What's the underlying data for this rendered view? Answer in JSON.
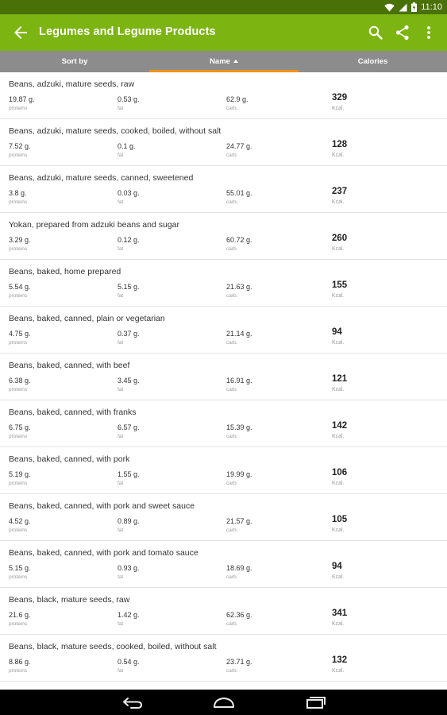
{
  "status": {
    "time": "11:10"
  },
  "app_bar": {
    "title": "Legumes and Legume Products"
  },
  "tabs": {
    "sort_by": "Sort by",
    "name": "Name",
    "calories": "Calories"
  },
  "foods": [
    {
      "name": "Beans, adzuki, mature seeds, raw",
      "protein": "19.87 g.",
      "fat": "0.53 g.",
      "carbs": "62.9 g.",
      "kcal": "329"
    },
    {
      "name": "Beans, adzuki, mature seeds, cooked, boiled, without salt",
      "protein": "7.52 g.",
      "fat": "0.1 g.",
      "carbs": "24.77 g.",
      "kcal": "128"
    },
    {
      "name": "Beans, adzuki, mature seeds, canned, sweetened",
      "protein": "3.8 g.",
      "fat": "0.03 g.",
      "carbs": "55.01 g.",
      "kcal": "237"
    },
    {
      "name": "Yokan, prepared from adzuki beans and sugar",
      "protein": "3.29 g.",
      "fat": "0.12 g.",
      "carbs": "60.72 g.",
      "kcal": "260"
    },
    {
      "name": "Beans, baked, home prepared",
      "protein": "5.54 g.",
      "fat": "5.15 g.",
      "carbs": "21.63 g.",
      "kcal": "155"
    },
    {
      "name": "Beans, baked, canned, plain or vegetarian",
      "protein": "4.75 g.",
      "fat": "0.37 g.",
      "carbs": "21.14 g.",
      "kcal": "94"
    },
    {
      "name": "Beans, baked, canned, with beef",
      "protein": "6.38 g.",
      "fat": "3.45 g.",
      "carbs": "16.91 g.",
      "kcal": "121"
    },
    {
      "name": "Beans, baked, canned, with franks",
      "protein": "6.75 g.",
      "fat": "6.57 g.",
      "carbs": "15.39 g.",
      "kcal": "142"
    },
    {
      "name": "Beans, baked, canned, with pork",
      "protein": "5.19 g.",
      "fat": "1.55 g.",
      "carbs": "19.99 g.",
      "kcal": "106"
    },
    {
      "name": "Beans, baked, canned, with pork and sweet sauce",
      "protein": "4.52 g.",
      "fat": "0.89 g.",
      "carbs": "21.57 g.",
      "kcal": "105"
    },
    {
      "name": "Beans, baked, canned, with pork and tomato sauce",
      "protein": "5.15 g.",
      "fat": "0.93 g.",
      "carbs": "18.69 g.",
      "kcal": "94"
    },
    {
      "name": "Beans, black, mature seeds, raw",
      "protein": "21.6 g.",
      "fat": "1.42 g.",
      "carbs": "62.36 g.",
      "kcal": "341"
    },
    {
      "name": "Beans, black, mature seeds, cooked, boiled, without salt",
      "protein": "8.86 g.",
      "fat": "0.54 g.",
      "carbs": "23.71 g.",
      "kcal": "132"
    }
  ],
  "labels": {
    "protein": "proteins",
    "fat": "fat",
    "carbs": "carb.",
    "kcal": "Kcal."
  },
  "colors": {
    "app_bar": "#7cb512",
    "status_bar": "#4a7008",
    "tab_bar": "#8c8c8c",
    "tab_indicator": "#f29318"
  }
}
